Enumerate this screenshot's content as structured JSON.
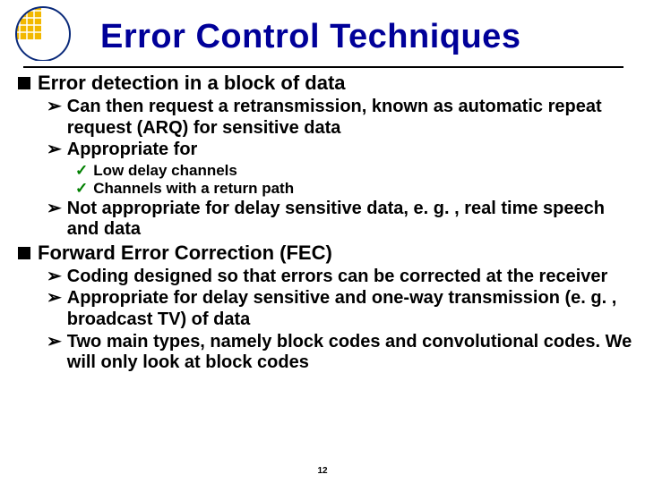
{
  "title": "Error Control Techniques",
  "section1": {
    "heading": "Error detection in a block of data",
    "b1": "Can then request a retransmission, known as automatic repeat request (ARQ) for sensitive data",
    "b2": "Appropriate for",
    "b2a": "Low delay channels",
    "b2b": "Channels with a return path",
    "b3": "Not appropriate for delay sensitive data, e. g. , real time speech and data"
  },
  "section2": {
    "heading": "Forward Error Correction (FEC)",
    "b1": "Coding designed so that errors can be corrected at the receiver",
    "b2": "Appropriate for delay sensitive and one-way transmission (e. g. , broadcast TV) of data",
    "b3": "Two main types, namely block codes and convolutional codes. We will only look at block codes"
  },
  "page": "12"
}
